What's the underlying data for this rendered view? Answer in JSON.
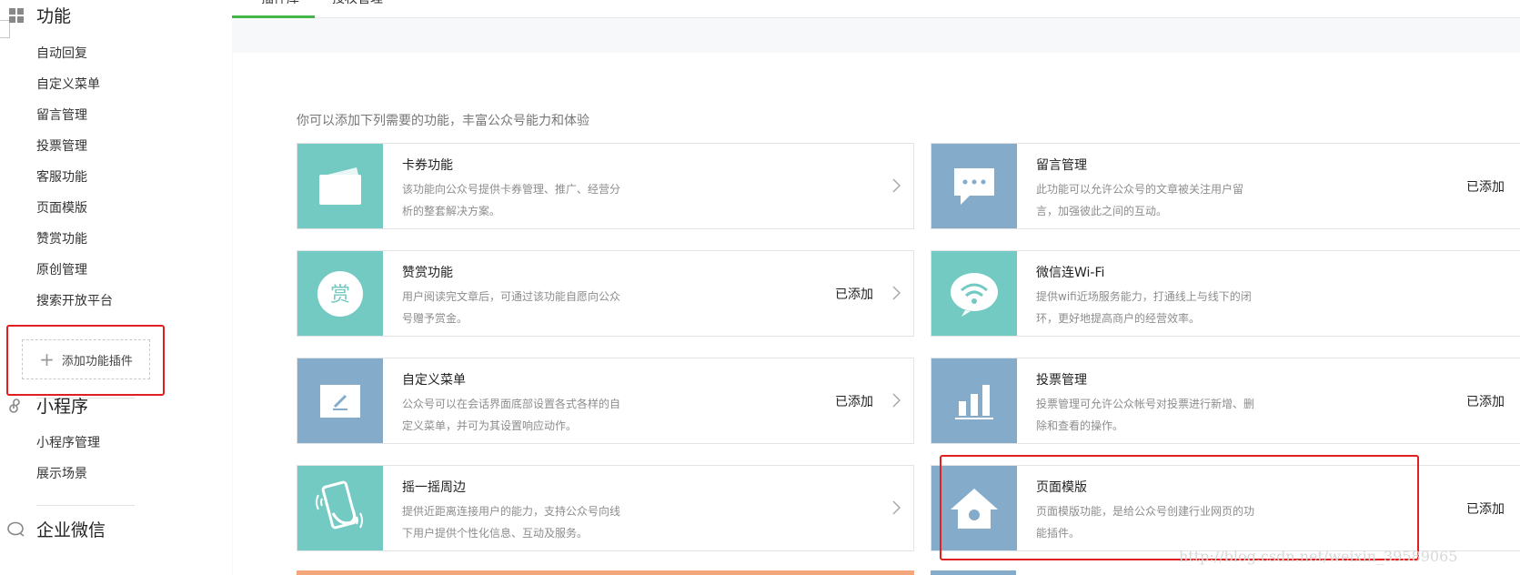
{
  "sidebar": {
    "sections": [
      {
        "title": "功能",
        "icon": "grid-icon"
      },
      {
        "title": "小程序",
        "icon": "link-icon"
      },
      {
        "title": "企业微信",
        "icon": "chat-bubble-icon"
      }
    ],
    "feature_items": [
      "自动回复",
      "自定义菜单",
      "留言管理",
      "投票管理",
      "客服功能",
      "页面模版",
      "赞赏功能",
      "原创管理",
      "搜索开放平台"
    ],
    "add_plugin_label": "添加功能插件",
    "miniprogram_items": [
      "小程序管理",
      "展示场景"
    ]
  },
  "tabs": [
    {
      "label": "插件库"
    },
    {
      "label": "授权管理"
    }
  ],
  "intro_text": "你可以添加下列需要的功能，丰富公众号能力和体验",
  "cards_left": [
    {
      "title": "卡券功能",
      "desc": "该功能向公众号提供卡券管理、推广、经营分析的整套解决方案。",
      "status": "",
      "icon": "card-wallet-icon",
      "color": "#72cac2"
    },
    {
      "title": "赞赏功能",
      "desc": "用户阅读完文章后，可通过该功能自愿向公众号赠予赏金。",
      "status": "已添加",
      "icon": "reward-icon",
      "color": "#72cac2"
    },
    {
      "title": "自定义菜单",
      "desc": "公众号可以在会话界面底部设置各式各样的自定义菜单，并可为其设置响应动作。",
      "status": "已添加",
      "icon": "edit-menu-icon",
      "color": "#85abca"
    },
    {
      "title": "摇一摇周边",
      "desc": "提供近距离连接用户的能力，支持公众号向线下用户提供个性化信息、互动及服务。",
      "status": "",
      "icon": "shake-phone-icon",
      "color": "#72cac2"
    }
  ],
  "cards_right": [
    {
      "title": "留言管理",
      "desc": "此功能可以允许公众号的文章被关注用户留言，加强彼此之间的互动。",
      "status": "已添加",
      "icon": "comment-icon",
      "color": "#85abca"
    },
    {
      "title": "微信连Wi-Fi",
      "desc": "提供wifi近场服务能力，打通线上与线下的闭环，更好地提高商户的经营效率。",
      "status": "",
      "icon": "wifi-icon",
      "color": "#72cac2"
    },
    {
      "title": "投票管理",
      "desc": "投票管理可允许公众帐号对投票进行新增、删除和查看的操作。",
      "status": "已添加",
      "icon": "bar-chart-icon",
      "color": "#85abca"
    },
    {
      "title": "页面模版",
      "desc": "页面模版功能，是给公众号创建行业网页的功能插件。",
      "status": "已添加",
      "icon": "house-icon",
      "color": "#85abca"
    }
  ],
  "watermark": "http://blog.csdn.net/weixin_39589065"
}
